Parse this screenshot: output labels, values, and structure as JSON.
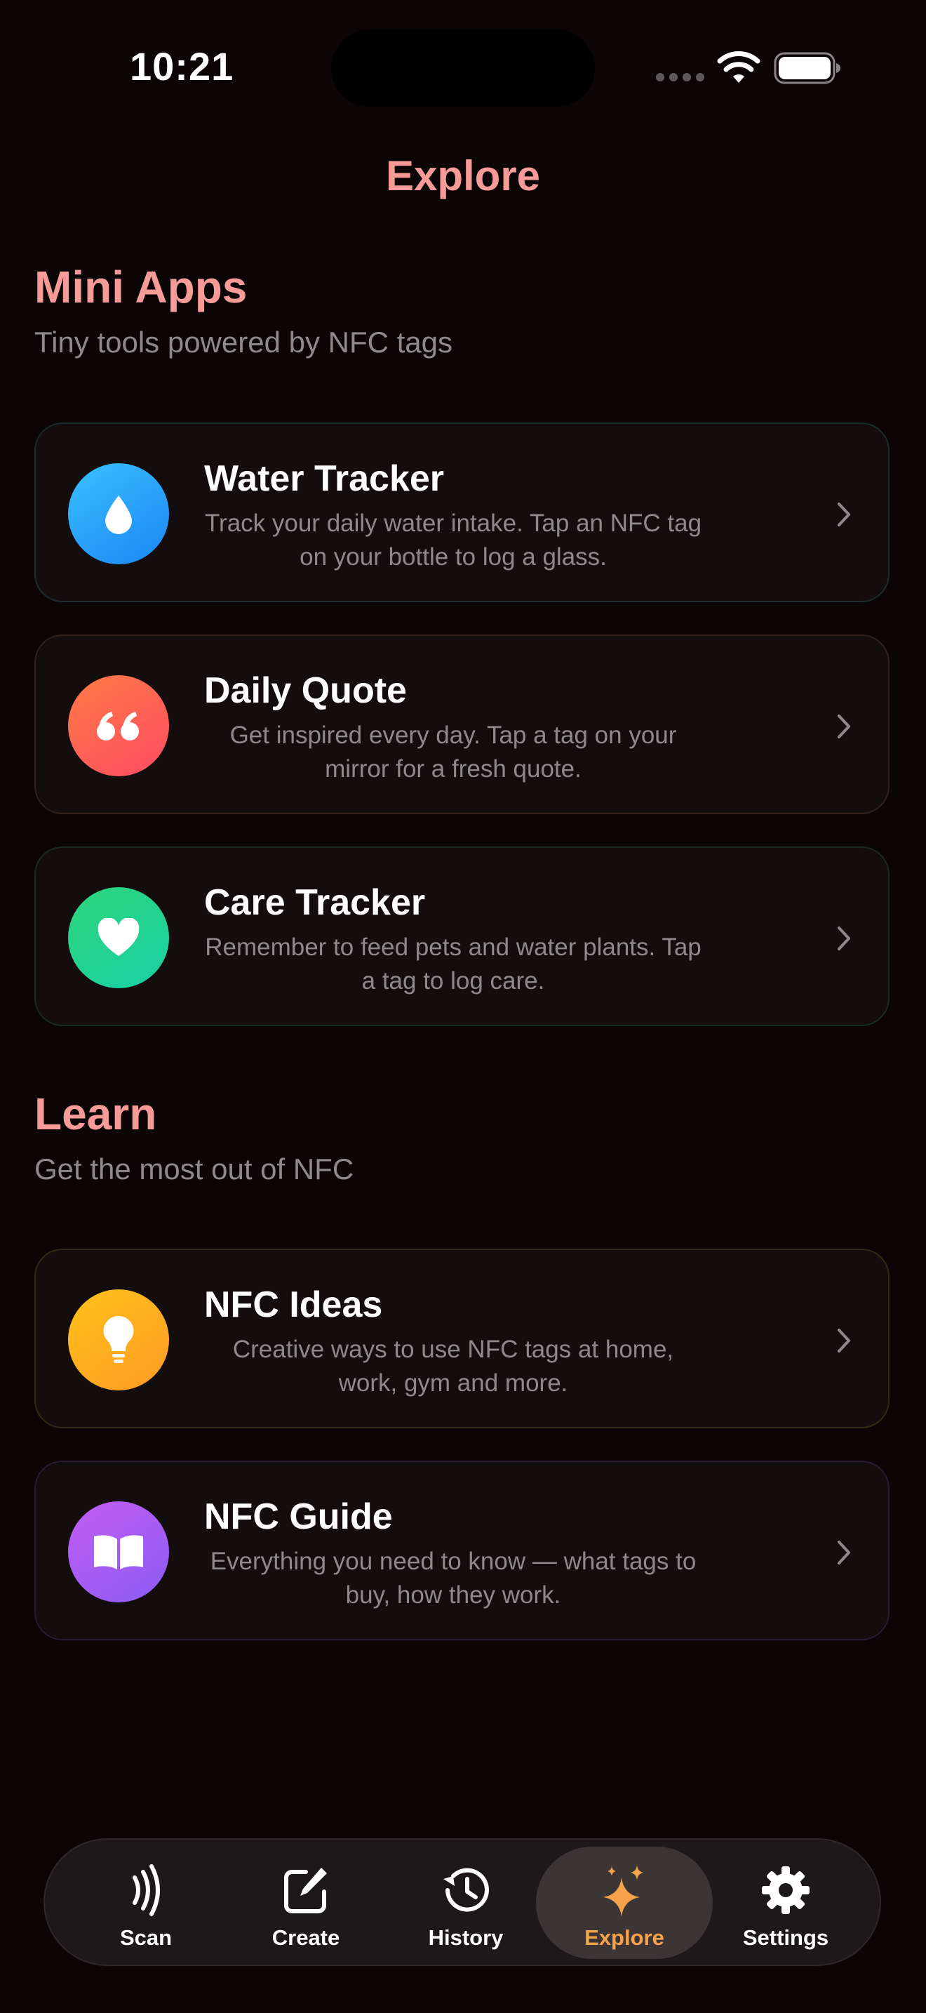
{
  "status_bar": {
    "time": "10:21"
  },
  "header": {
    "title": "Explore"
  },
  "sections": {
    "mini_apps": {
      "title": "Mini Apps",
      "subtitle": "Tiny tools powered by NFC tags",
      "items": [
        {
          "title": "Water Tracker",
          "description": "Track your daily water intake. Tap an NFC tag on your bottle to log a glass.",
          "icon": "water-drop-icon",
          "colors": [
            "#3ac0ff",
            "#1a87f5"
          ]
        },
        {
          "title": "Daily Quote",
          "description": "Get inspired every day. Tap a tag on your mirror for a fresh quote.",
          "icon": "quote-icon",
          "colors": [
            "#ff7a45",
            "#ff4c63"
          ]
        },
        {
          "title": "Care Tracker",
          "description": "Remember to feed pets and water plants. Tap a tag to log care.",
          "icon": "heart-icon",
          "colors": [
            "#2ed47a",
            "#19d1a6"
          ]
        }
      ]
    },
    "learn": {
      "title": "Learn",
      "subtitle": "Get the most out of NFC",
      "items": [
        {
          "title": "NFC Ideas",
          "description": "Creative ways to use NFC tags at home, work, gym and more.",
          "icon": "lightbulb-icon",
          "colors": [
            "#ffc21a",
            "#ff9a25"
          ]
        },
        {
          "title": "NFC Guide",
          "description": "Everything you need to know — what tags to buy, how they work.",
          "icon": "book-icon",
          "colors": [
            "#c45cf5",
            "#8a5cf2"
          ]
        }
      ]
    }
  },
  "tab_bar": {
    "tabs": [
      {
        "label": "Scan",
        "icon": "nfc-scan-icon",
        "active": false
      },
      {
        "label": "Create",
        "icon": "compose-icon",
        "active": false
      },
      {
        "label": "History",
        "icon": "history-icon",
        "active": false
      },
      {
        "label": "Explore",
        "icon": "sparkles-icon",
        "active": true
      },
      {
        "label": "Settings",
        "icon": "gear-icon",
        "active": false
      }
    ]
  },
  "colors": {
    "background": "#0b0506",
    "accent_title": "#f79b98",
    "active_tab": "#f5a24a"
  }
}
